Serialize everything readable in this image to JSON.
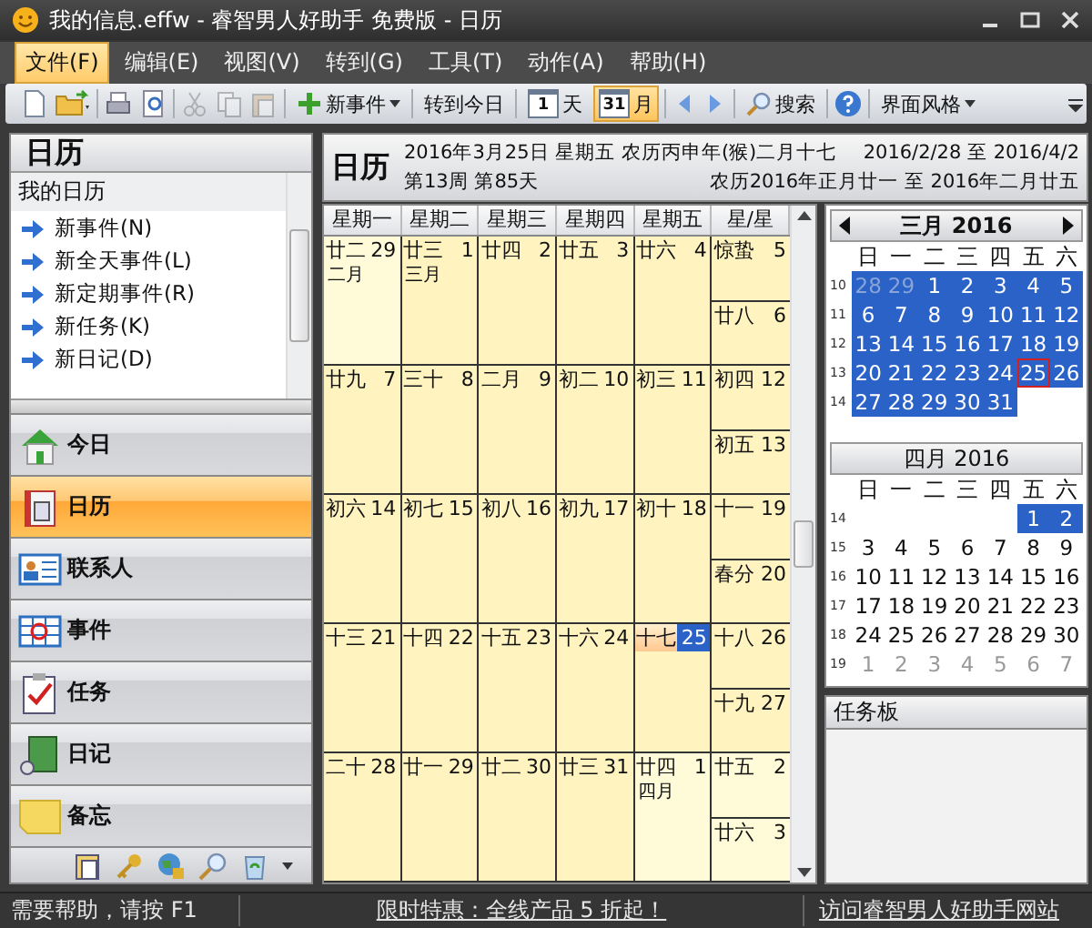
{
  "window": {
    "title": "我的信息.effw - 睿智男人好助手 免费版 - 日历"
  },
  "menu": [
    {
      "label": "文件(F)",
      "selected": true
    },
    {
      "label": "编辑(E)",
      "selected": false
    },
    {
      "label": "视图(V)",
      "selected": false
    },
    {
      "label": "转到(G)",
      "selected": false
    },
    {
      "label": "工具(T)",
      "selected": false
    },
    {
      "label": "动作(A)",
      "selected": false
    },
    {
      "label": "帮助(H)",
      "selected": false
    }
  ],
  "toolbar": {
    "edit_disabled": true,
    "new_event": "新事件",
    "go_today": "转到今日",
    "views": [
      {
        "icon_text": "1",
        "label": "天",
        "selected": false
      },
      {
        "icon_text": "31",
        "label": "月",
        "selected": true
      }
    ],
    "search": "搜索",
    "skin": "界面风格"
  },
  "sidebar": {
    "header": "日历",
    "list_title": "我的日历",
    "actions": [
      "新事件(N)",
      "新全天事件(L)",
      "新定期事件(R)",
      "新任务(K)",
      "新日记(D)"
    ],
    "nav": [
      {
        "label": "今日",
        "selected": false
      },
      {
        "label": "日历",
        "selected": true
      },
      {
        "label": "联系人",
        "selected": false
      },
      {
        "label": "事件",
        "selected": false
      },
      {
        "label": "任务",
        "selected": false
      },
      {
        "label": "日记",
        "selected": false
      },
      {
        "label": "备忘",
        "selected": false
      }
    ]
  },
  "calendar": {
    "title": "日历",
    "date_line": "2016年3月25日 星期五 农历丙申年(猴)二月十七",
    "week_line": "第13周 第85天",
    "range": "2016/2/28 至 2016/4/2",
    "lunar_range": "农历2016年正月廿一 至 2016年二月廿五",
    "weekdays": [
      "星期一",
      "星期二",
      "星期三",
      "星期四",
      "星期五",
      "星/星"
    ],
    "weeks": [
      [
        {
          "lunar": "廿二",
          "month_label": "二月",
          "day": "29",
          "other_month": true,
          "today": false
        },
        {
          "lunar": "廿三",
          "month_label": "三月",
          "day": "1",
          "other_month": false,
          "today": false
        },
        {
          "lunar": "廿四",
          "day": "2",
          "other_month": false,
          "today": false
        },
        {
          "lunar": "廿五",
          "day": "3",
          "other_month": false,
          "today": false
        },
        {
          "lunar": "廿六",
          "day": "4",
          "other_month": false,
          "today": false
        },
        {
          "lunar": "惊蛰",
          "day": "5",
          "other_month": false,
          "today": false
        },
        {
          "lunar": "廿八",
          "day": "6",
          "other_month": false,
          "today": false
        }
      ],
      [
        {
          "lunar": "廿九",
          "day": "7",
          "other_month": false,
          "today": false
        },
        {
          "lunar": "三十",
          "day": "8",
          "other_month": false,
          "today": false
        },
        {
          "lunar": "二月",
          "day": "9",
          "other_month": false,
          "today": false
        },
        {
          "lunar": "初二",
          "day": "10",
          "other_month": false,
          "today": false
        },
        {
          "lunar": "初三",
          "day": "11",
          "other_month": false,
          "today": false
        },
        {
          "lunar": "初四",
          "day": "12",
          "other_month": false,
          "today": false
        },
        {
          "lunar": "初五",
          "day": "13",
          "other_month": false,
          "today": false
        }
      ],
      [
        {
          "lunar": "初六",
          "day": "14",
          "other_month": false,
          "today": false
        },
        {
          "lunar": "初七",
          "day": "15",
          "other_month": false,
          "today": false
        },
        {
          "lunar": "初八",
          "day": "16",
          "other_month": false,
          "today": false
        },
        {
          "lunar": "初九",
          "day": "17",
          "other_month": false,
          "today": false
        },
        {
          "lunar": "初十",
          "day": "18",
          "other_month": false,
          "today": false
        },
        {
          "lunar": "十一",
          "day": "19",
          "other_month": false,
          "today": false
        },
        {
          "lunar": "春分",
          "day": "20",
          "other_month": false,
          "today": false
        }
      ],
      [
        {
          "lunar": "十三",
          "day": "21",
          "other_month": false,
          "today": false
        },
        {
          "lunar": "十四",
          "day": "22",
          "other_month": false,
          "today": false
        },
        {
          "lunar": "十五",
          "day": "23",
          "other_month": false,
          "today": false
        },
        {
          "lunar": "十六",
          "day": "24",
          "other_month": false,
          "today": false
        },
        {
          "lunar": "十七",
          "day": "25",
          "other_month": false,
          "today": true
        },
        {
          "lunar": "十八",
          "day": "26",
          "other_month": false,
          "today": false
        },
        {
          "lunar": "十九",
          "day": "27",
          "other_month": false,
          "today": false
        }
      ],
      [
        {
          "lunar": "二十",
          "day": "28",
          "other_month": false,
          "today": false
        },
        {
          "lunar": "廿一",
          "day": "29",
          "other_month": false,
          "today": false
        },
        {
          "lunar": "廿二",
          "day": "30",
          "other_month": false,
          "today": false
        },
        {
          "lunar": "廿三",
          "day": "31",
          "other_month": false,
          "today": false
        },
        {
          "lunar": "廿四",
          "month_label": "四月",
          "day": "1",
          "other_month": true,
          "today": false
        },
        {
          "lunar": "廿五",
          "day": "2",
          "other_month": true,
          "today": false
        },
        {
          "lunar": "廿六",
          "day": "3",
          "other_month": true,
          "today": false
        }
      ]
    ]
  },
  "mini_calendars": [
    {
      "title": "三月 2016",
      "navigation": true,
      "weekdays": [
        "日",
        "一",
        "二",
        "三",
        "四",
        "五",
        "六"
      ],
      "weeks": [
        {
          "number": "10",
          "kind": "full",
          "days": [
            {
              "day": "28",
              "other_month": true,
              "selected": true,
              "today": false
            },
            {
              "day": "29",
              "other_month": true,
              "selected": true,
              "today": false
            },
            {
              "day": "1",
              "other_month": false,
              "selected": true,
              "today": false
            },
            {
              "day": "2",
              "other_month": false,
              "selected": true,
              "today": false
            },
            {
              "day": "3",
              "other_month": false,
              "selected": true,
              "today": false
            },
            {
              "day": "4",
              "other_month": false,
              "selected": true,
              "today": false
            },
            {
              "day": "5",
              "other_month": false,
              "selected": true,
              "today": false
            }
          ]
        },
        {
          "number": "11",
          "kind": "full",
          "days": [
            {
              "day": "6",
              "other_month": false,
              "selected": true,
              "today": false
            },
            {
              "day": "7",
              "other_month": false,
              "selected": true,
              "today": false
            },
            {
              "day": "8",
              "other_month": false,
              "selected": true,
              "today": false
            },
            {
              "day": "9",
              "other_month": false,
              "selected": true,
              "today": false
            },
            {
              "day": "10",
              "other_month": false,
              "selected": true,
              "today": false
            },
            {
              "day": "11",
              "other_month": false,
              "selected": true,
              "today": false
            },
            {
              "day": "12",
              "other_month": false,
              "selected": true,
              "today": false
            }
          ]
        },
        {
          "number": "12",
          "kind": "full",
          "days": [
            {
              "day": "13",
              "other_month": false,
              "selected": true,
              "today": false
            },
            {
              "day": "14",
              "other_month": false,
              "selected": true,
              "today": false
            },
            {
              "day": "15",
              "other_month": false,
              "selected": true,
              "today": false
            },
            {
              "day": "16",
              "other_month": false,
              "selected": true,
              "today": false
            },
            {
              "day": "17",
              "other_month": false,
              "selected": true,
              "today": false
            },
            {
              "day": "18",
              "other_month": false,
              "selected": true,
              "today": false
            },
            {
              "day": "19",
              "other_month": false,
              "selected": true,
              "today": false
            }
          ]
        },
        {
          "number": "13",
          "kind": "full",
          "days": [
            {
              "day": "20",
              "other_month": false,
              "selected": true,
              "today": false
            },
            {
              "day": "21",
              "other_month": false,
              "selected": true,
              "today": false
            },
            {
              "day": "22",
              "other_month": false,
              "selected": true,
              "today": false
            },
            {
              "day": "23",
              "other_month": false,
              "selected": true,
              "today": false
            },
            {
              "day": "24",
              "other_month": false,
              "selected": true,
              "today": false
            },
            {
              "day": "25",
              "other_month": false,
              "selected": true,
              "today": true
            },
            {
              "day": "26",
              "other_month": false,
              "selected": true,
              "today": false
            }
          ]
        },
        {
          "number": "14",
          "kind": "start",
          "days": [
            {
              "day": "27",
              "other_month": false,
              "selected": true,
              "today": false
            },
            {
              "day": "28",
              "other_month": false,
              "selected": true,
              "today": false
            },
            {
              "day": "29",
              "other_month": false,
              "selected": true,
              "today": false
            },
            {
              "day": "30",
              "other_month": false,
              "selected": true,
              "today": false
            },
            {
              "day": "31",
              "other_month": false,
              "selected": true,
              "today": false
            }
          ]
        }
      ]
    },
    {
      "title": "四月 2016",
      "navigation": false,
      "weekdays": [
        "日",
        "一",
        "二",
        "三",
        "四",
        "五",
        "六"
      ],
      "weeks": [
        {
          "number": "14",
          "kind": "end",
          "days": [
            {
              "day": "1",
              "other_month": false,
              "selected": true,
              "today": false
            },
            {
              "day": "2",
              "other_month": false,
              "selected": true,
              "today": false
            }
          ]
        },
        {
          "number": "15",
          "kind": "full",
          "days": [
            {
              "day": "3",
              "other_month": false,
              "selected": false,
              "today": false
            },
            {
              "day": "4",
              "other_month": false,
              "selected": false,
              "today": false
            },
            {
              "day": "5",
              "other_month": false,
              "selected": false,
              "today": false
            },
            {
              "day": "6",
              "other_month": false,
              "selected": false,
              "today": false
            },
            {
              "day": "7",
              "other_month": false,
              "selected": false,
              "today": false
            },
            {
              "day": "8",
              "other_month": false,
              "selected": false,
              "today": false
            },
            {
              "day": "9",
              "other_month": false,
              "selected": false,
              "today": false
            }
          ]
        },
        {
          "number": "16",
          "kind": "full",
          "days": [
            {
              "day": "10",
              "other_month": false,
              "selected": false,
              "today": false
            },
            {
              "day": "11",
              "other_month": false,
              "selected": false,
              "today": false
            },
            {
              "day": "12",
              "other_month": false,
              "selected": false,
              "today": false
            },
            {
              "day": "13",
              "other_month": false,
              "selected": false,
              "today": false
            },
            {
              "day": "14",
              "other_month": false,
              "selected": false,
              "today": false
            },
            {
              "day": "15",
              "other_month": false,
              "selected": false,
              "today": false
            },
            {
              "day": "16",
              "other_month": false,
              "selected": false,
              "today": false
            }
          ]
        },
        {
          "number": "17",
          "kind": "full",
          "days": [
            {
              "day": "17",
              "other_month": false,
              "selected": false,
              "today": false
            },
            {
              "day": "18",
              "other_month": false,
              "selected": false,
              "today": false
            },
            {
              "day": "19",
              "other_month": false,
              "selected": false,
              "today": false
            },
            {
              "day": "20",
              "other_month": false,
              "selected": false,
              "today": false
            },
            {
              "day": "21",
              "other_month": false,
              "selected": false,
              "today": false
            },
            {
              "day": "22",
              "other_month": false,
              "selected": false,
              "today": false
            },
            {
              "day": "23",
              "other_month": false,
              "selected": false,
              "today": false
            }
          ]
        },
        {
          "number": "18",
          "kind": "full",
          "days": [
            {
              "day": "24",
              "other_month": false,
              "selected": false,
              "today": false
            },
            {
              "day": "25",
              "other_month": false,
              "selected": false,
              "today": false
            },
            {
              "day": "26",
              "other_month": false,
              "selected": false,
              "today": false
            },
            {
              "day": "27",
              "other_month": false,
              "selected": false,
              "today": false
            },
            {
              "day": "28",
              "other_month": false,
              "selected": false,
              "today": false
            },
            {
              "day": "29",
              "other_month": false,
              "selected": false,
              "today": false
            },
            {
              "day": "30",
              "other_month": false,
              "selected": false,
              "today": false
            }
          ]
        },
        {
          "number": "19",
          "kind": "full",
          "days": [
            {
              "day": "1",
              "other_month": true,
              "selected": false,
              "today": false
            },
            {
              "day": "2",
              "other_month": true,
              "selected": false,
              "today": false
            },
            {
              "day": "3",
              "other_month": true,
              "selected": false,
              "today": false
            },
            {
              "day": "4",
              "other_month": true,
              "selected": false,
              "today": false
            },
            {
              "day": "5",
              "other_month": true,
              "selected": false,
              "today": false
            },
            {
              "day": "6",
              "other_month": true,
              "selected": false,
              "today": false
            },
            {
              "day": "7",
              "other_month": true,
              "selected": false,
              "today": false
            }
          ]
        }
      ]
    }
  ],
  "task_board": {
    "title": "任务板"
  },
  "status_bar": {
    "help": "需要帮助，请按 F1",
    "promo": "限时特惠：全线产品 5 折起！",
    "site": "访问睿智男人好助手网站"
  }
}
